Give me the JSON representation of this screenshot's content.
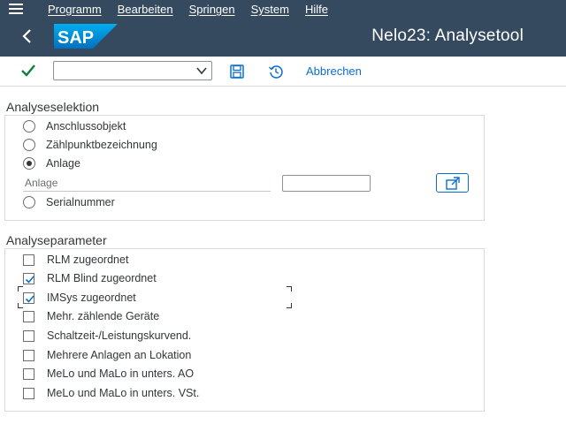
{
  "menubar": {
    "items": [
      "Programm",
      "Bearbeiten",
      "Springen",
      "System",
      "Hilfe"
    ]
  },
  "shell": {
    "title": "Nelo23: Analysetool",
    "logo_text": "SAP"
  },
  "toolbar": {
    "command_value": "",
    "cancel_label": "Abbrechen"
  },
  "analyseselektion": {
    "title": "Analyseselektion",
    "options": [
      {
        "label": "Anschlussobjekt",
        "selected": false
      },
      {
        "label": "Zählpunktbezeichnung",
        "selected": false
      },
      {
        "label": "Anlage",
        "selected": true
      },
      {
        "label": "Serialnummer",
        "selected": false
      }
    ],
    "anlage_field_label": "Anlage",
    "anlage_value": ""
  },
  "analyseparameter": {
    "title": "Analyseparameter",
    "items": [
      {
        "label": "RLM zugeordnet",
        "checked": false
      },
      {
        "label": "RLM Blind zugeordnet",
        "checked": true
      },
      {
        "label": "IMSys zugeordnet",
        "checked": true
      },
      {
        "label": "Mehr. zählende Geräte",
        "checked": false
      },
      {
        "label": "Schaltzeit-/Leistungskurvend.",
        "checked": false
      },
      {
        "label": "Mehrere Anlagen an Lokation",
        "checked": false
      },
      {
        "label": "MeLo und MaLo in unters. AO",
        "checked": false
      },
      {
        "label": "MeLo und MaLo in unters. VSt.",
        "checked": false
      }
    ]
  },
  "colors": {
    "shell_bg": "#354a5f",
    "accent": "#0a6ed1",
    "check_green": "#107e3e"
  }
}
